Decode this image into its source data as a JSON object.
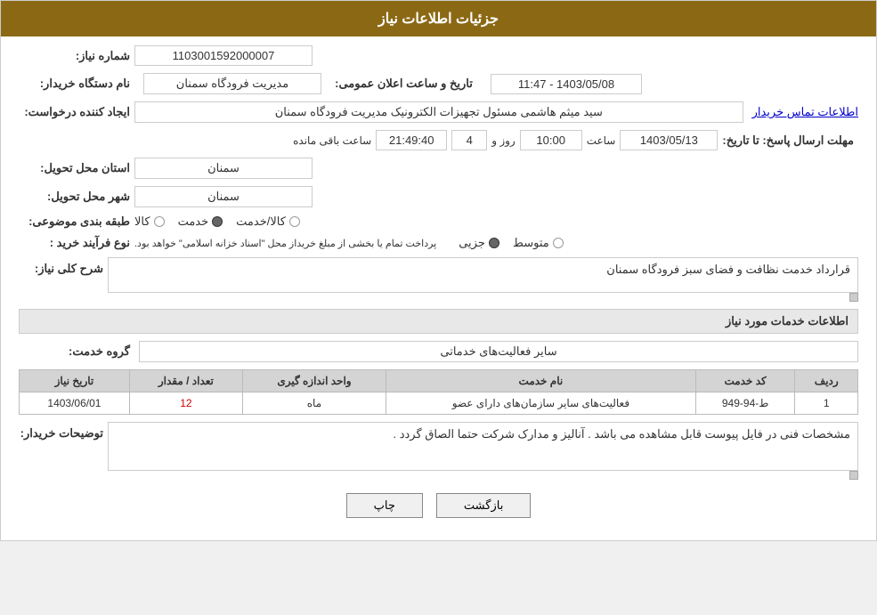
{
  "header": {
    "title": "جزئیات اطلاعات نیاز"
  },
  "fields": {
    "need_number_label": "شماره نیاز:",
    "need_number_value": "1103001592000007",
    "agency_label": "نام دستگاه خریدار:",
    "agency_value": "مدیریت فرودگاه سمنان",
    "announce_date_label": "تاریخ و ساعت اعلان عمومی:",
    "announce_date_value": "1403/05/08 - 11:47",
    "creator_label": "ایجاد کننده درخواست:",
    "creator_value": "سید میثم هاشمی مسئول تجهیزات الکترونیک مدیریت فرودگاه سمنان",
    "contact_link": "اطلاعات تماس خریدار",
    "deadline_label": "مهلت ارسال پاسخ: تا تاریخ:",
    "deadline_date": "1403/05/13",
    "deadline_time_label": "ساعت",
    "deadline_time_value": "10:00",
    "deadline_days_label": "روز و",
    "deadline_days_value": "4",
    "deadline_remaining_label": "ساعت باقی مانده",
    "deadline_remaining_value": "21:49:40",
    "province_label": "استان محل تحویل:",
    "province_value": "سمنان",
    "city_label": "شهر محل تحویل:",
    "city_value": "سمنان",
    "category_label": "طبقه بندی موضوعی:",
    "category_options": [
      "کالا",
      "خدمت",
      "کالا/خدمت"
    ],
    "category_selected": "خدمت",
    "purchase_type_label": "نوع فرآیند خرید :",
    "purchase_type_options": [
      "جزیی",
      "متوسط"
    ],
    "purchase_type_note": "پرداخت تمام یا بخشی از مبلغ خریداز محل \"اسناد خزانه اسلامی\" خواهد بود.",
    "description_label": "شرح کلی نیاز:",
    "description_value": "قرارداد خدمت نظافت و فضای سبز فرودگاه سمنان",
    "services_section_title": "اطلاعات خدمات مورد نیاز",
    "service_group_label": "گروه خدمت:",
    "service_group_value": "سایر فعالیت‌های خدماتی",
    "table_headers": [
      "ردیف",
      "کد خدمت",
      "نام خدمت",
      "واحد اندازه گیری",
      "تعداد / مقدار",
      "تاریخ نیاز"
    ],
    "table_rows": [
      {
        "row": "1",
        "code": "ط-94-949",
        "name": "فعالیت‌های سایر سازمان‌های دارای عضو",
        "unit": "ماه",
        "quantity": "12",
        "date": "1403/06/01"
      }
    ],
    "buyer_description_label": "توضیحات خریدار:",
    "buyer_description_value": "مشخصات فنی در فایل پیوست قابل مشاهده می باشد . آنالیز و مدارک شرکت حتما الصاق گردد ."
  },
  "buttons": {
    "print_label": "چاپ",
    "back_label": "بازگشت"
  }
}
